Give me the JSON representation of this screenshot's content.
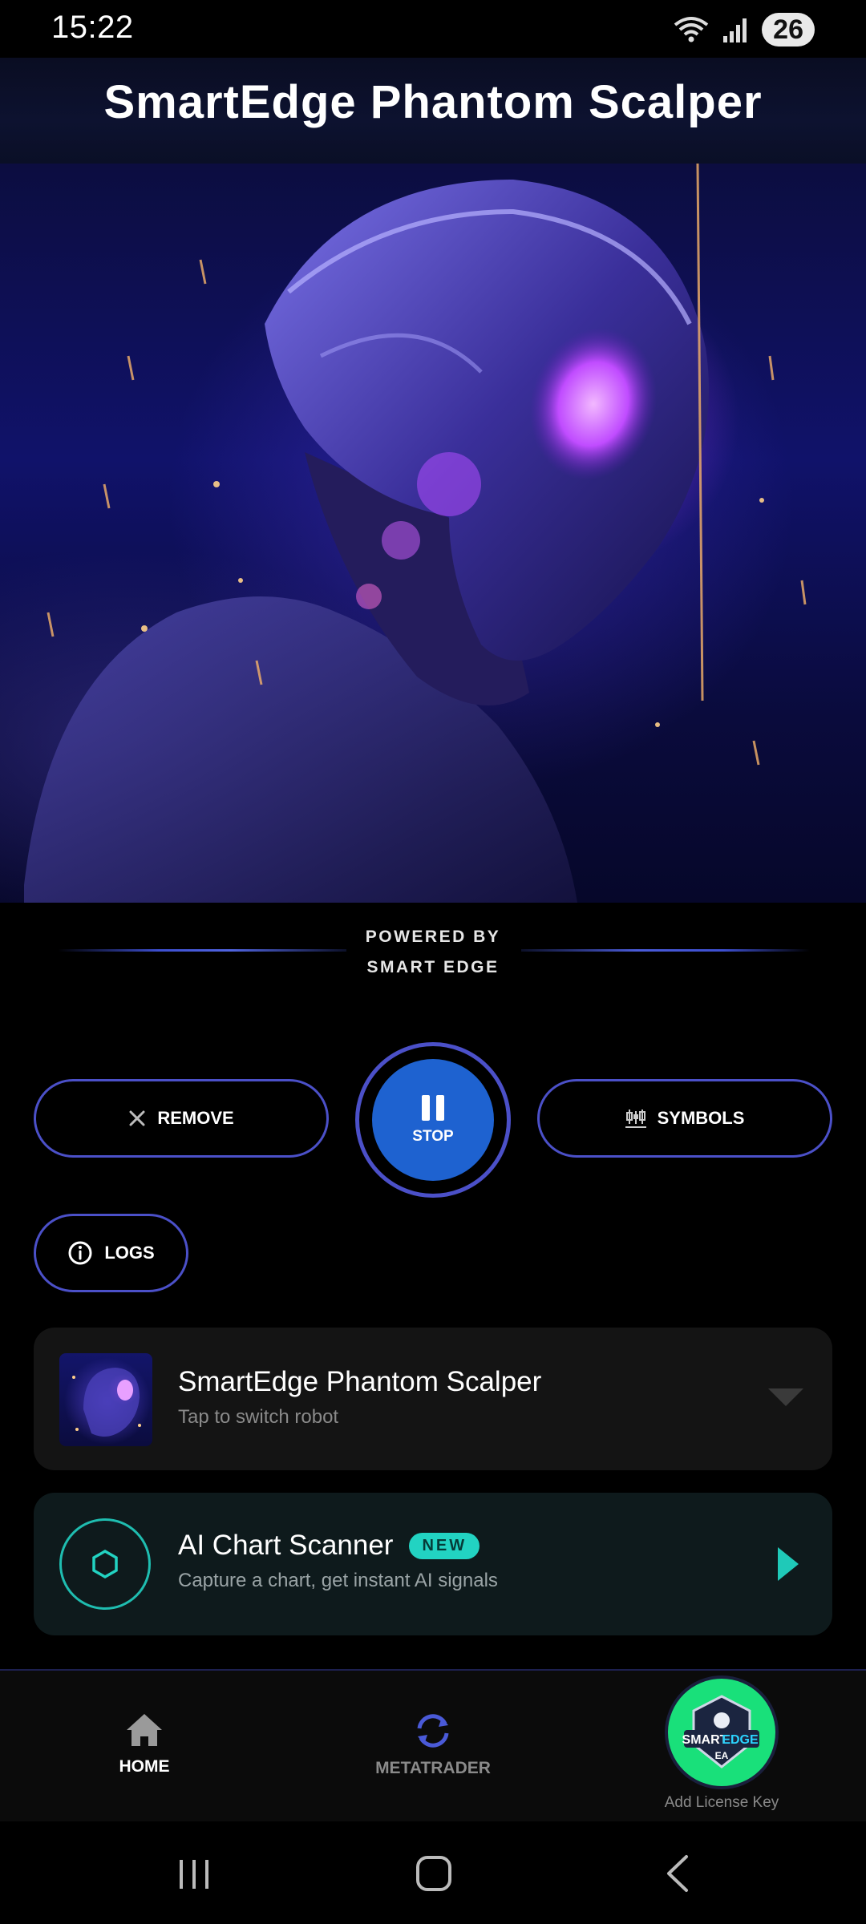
{
  "status_bar": {
    "time": "15:22",
    "battery": "26"
  },
  "header": {
    "title": "SmartEdge Phantom Scalper"
  },
  "hero": {
    "image_alt": "purple cyborg robot artwork"
  },
  "powered_by": {
    "line1": "POWERED BY",
    "line2": "SMART EDGE"
  },
  "controls": {
    "remove_label": "REMOVE",
    "stop_label": "STOP",
    "symbols_label": "SYMBOLS",
    "logs_label": "LOGS"
  },
  "robot_card": {
    "title": "SmartEdge Phantom Scalper",
    "subtitle": "Tap to switch robot"
  },
  "scanner_card": {
    "title": "AI Chart Scanner",
    "badge": "NEW",
    "subtitle": "Capture a chart, get instant AI signals"
  },
  "bottom_nav": {
    "home_label": "HOME",
    "metatrader_label": "METATRADER",
    "license_label": "Add License Key",
    "logo_text_top": "SMART",
    "logo_text_accent": "EDGE",
    "logo_text_bottom": "EA"
  },
  "colors": {
    "accent_border": "#4b50c8",
    "stop_button": "#1e62d0",
    "teal": "#22d3c2",
    "license_green": "#19e07a"
  },
  "icons": {
    "remove": "close-icon",
    "stop": "pause-icon",
    "symbols": "candlestick-icon",
    "logs": "info-icon",
    "robot_dropdown": "chevron-down-icon",
    "scanner": "hexagon-icon",
    "scanner_arrow": "play-arrow-icon",
    "home": "home-icon",
    "metatrader": "sync-icon"
  }
}
